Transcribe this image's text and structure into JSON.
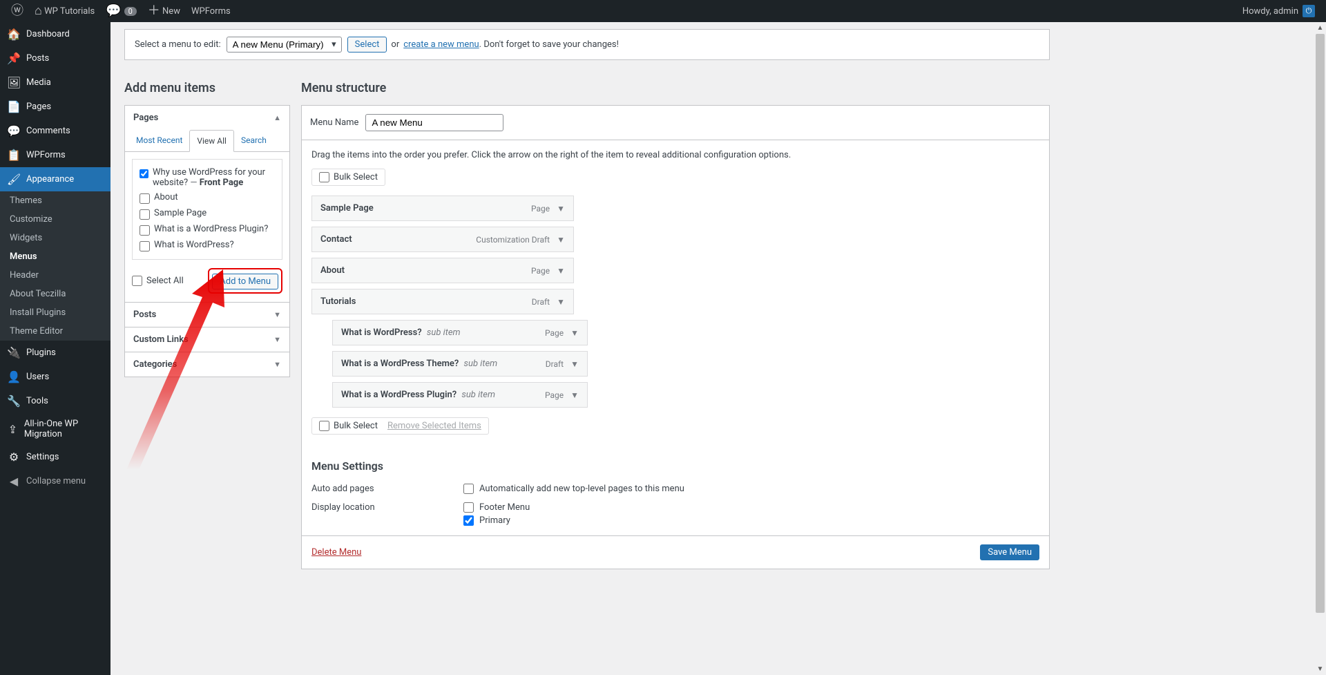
{
  "adminbar": {
    "site_name": "WP Tutorials",
    "comments_count": "0",
    "new_label": "New",
    "wpforms_label": "WPForms",
    "howdy": "Howdy, admin",
    "avatar_glyph": "⏻"
  },
  "adminmenu": {
    "items": [
      {
        "icon": "🏠",
        "label": "Dashboard"
      },
      {
        "icon": "📌",
        "label": "Posts"
      },
      {
        "icon": "🖼",
        "label": "Media"
      },
      {
        "icon": "📄",
        "label": "Pages"
      },
      {
        "icon": "💬",
        "label": "Comments"
      },
      {
        "icon": "📋",
        "label": "WPForms"
      },
      {
        "icon": "🖌",
        "label": "Appearance",
        "current": true,
        "submenu": [
          {
            "label": "Themes"
          },
          {
            "label": "Customize"
          },
          {
            "label": "Widgets"
          },
          {
            "label": "Menus",
            "current": true
          },
          {
            "label": "Header"
          },
          {
            "label": "About Teczilla"
          },
          {
            "label": "Install Plugins"
          },
          {
            "label": "Theme Editor"
          }
        ]
      },
      {
        "icon": "🔌",
        "label": "Plugins"
      },
      {
        "icon": "👤",
        "label": "Users"
      },
      {
        "icon": "🔧",
        "label": "Tools"
      },
      {
        "icon": "⇪",
        "label": "All-in-One WP Migration"
      },
      {
        "icon": "⚙",
        "label": "Settings"
      }
    ],
    "collapse_label": "Collapse menu"
  },
  "manage": {
    "prompt": "Select a menu to edit:",
    "dropdown_value": "A new Menu (Primary)",
    "select_btn": "Select",
    "or": "or",
    "create_link": "create a new menu",
    "dont_forget": ". Don't forget to save your changes!"
  },
  "leftcol": {
    "title": "Add menu items",
    "sections": {
      "pages": {
        "title": "Pages",
        "tabs": {
          "recent": "Most Recent",
          "all": "View All",
          "search": "Search"
        },
        "items": [
          {
            "label": "Why use WordPress for your website?",
            "front_suffix": " — ",
            "front_label": "Front Page",
            "checked": true
          },
          {
            "label": "About"
          },
          {
            "label": "Sample Page"
          },
          {
            "label": "What is a WordPress Plugin?"
          },
          {
            "label": "What is WordPress?"
          }
        ],
        "select_all": "Select All",
        "add_btn": "Add to Menu"
      },
      "posts": "Posts",
      "custom_links": "Custom Links",
      "categories": "Categories"
    }
  },
  "rightcol": {
    "title": "Menu structure",
    "name_label": "Menu Name",
    "name_value": "A new Menu",
    "drag_text": "Drag the items into the order you prefer. Click the arrow on the right of the item to reveal additional configuration options.",
    "bulk_select": "Bulk Select",
    "remove_selected": "Remove Selected Items",
    "tree": [
      {
        "title": "Sample Page",
        "type": "Page",
        "depth": 0
      },
      {
        "title": "Contact",
        "type": "Customization Draft",
        "depth": 0
      },
      {
        "title": "About",
        "type": "Page",
        "depth": 0
      },
      {
        "title": "Tutorials",
        "type": "Draft",
        "depth": 0
      },
      {
        "title": "What is WordPress?",
        "sub": "sub item",
        "type": "Page",
        "depth": 1
      },
      {
        "title": "What is a WordPress Theme?",
        "sub": "sub item",
        "type": "Draft",
        "depth": 1
      },
      {
        "title": "What is a WordPress Plugin?",
        "sub": "sub item",
        "type": "Page",
        "depth": 1
      }
    ],
    "settings": {
      "title": "Menu Settings",
      "auto_add_label": "Auto add pages",
      "auto_add_option": "Automatically add new top-level pages to this menu",
      "display_label": "Display location",
      "loc_footer": "Footer Menu",
      "loc_primary": "Primary"
    },
    "delete": "Delete Menu",
    "save": "Save Menu"
  }
}
